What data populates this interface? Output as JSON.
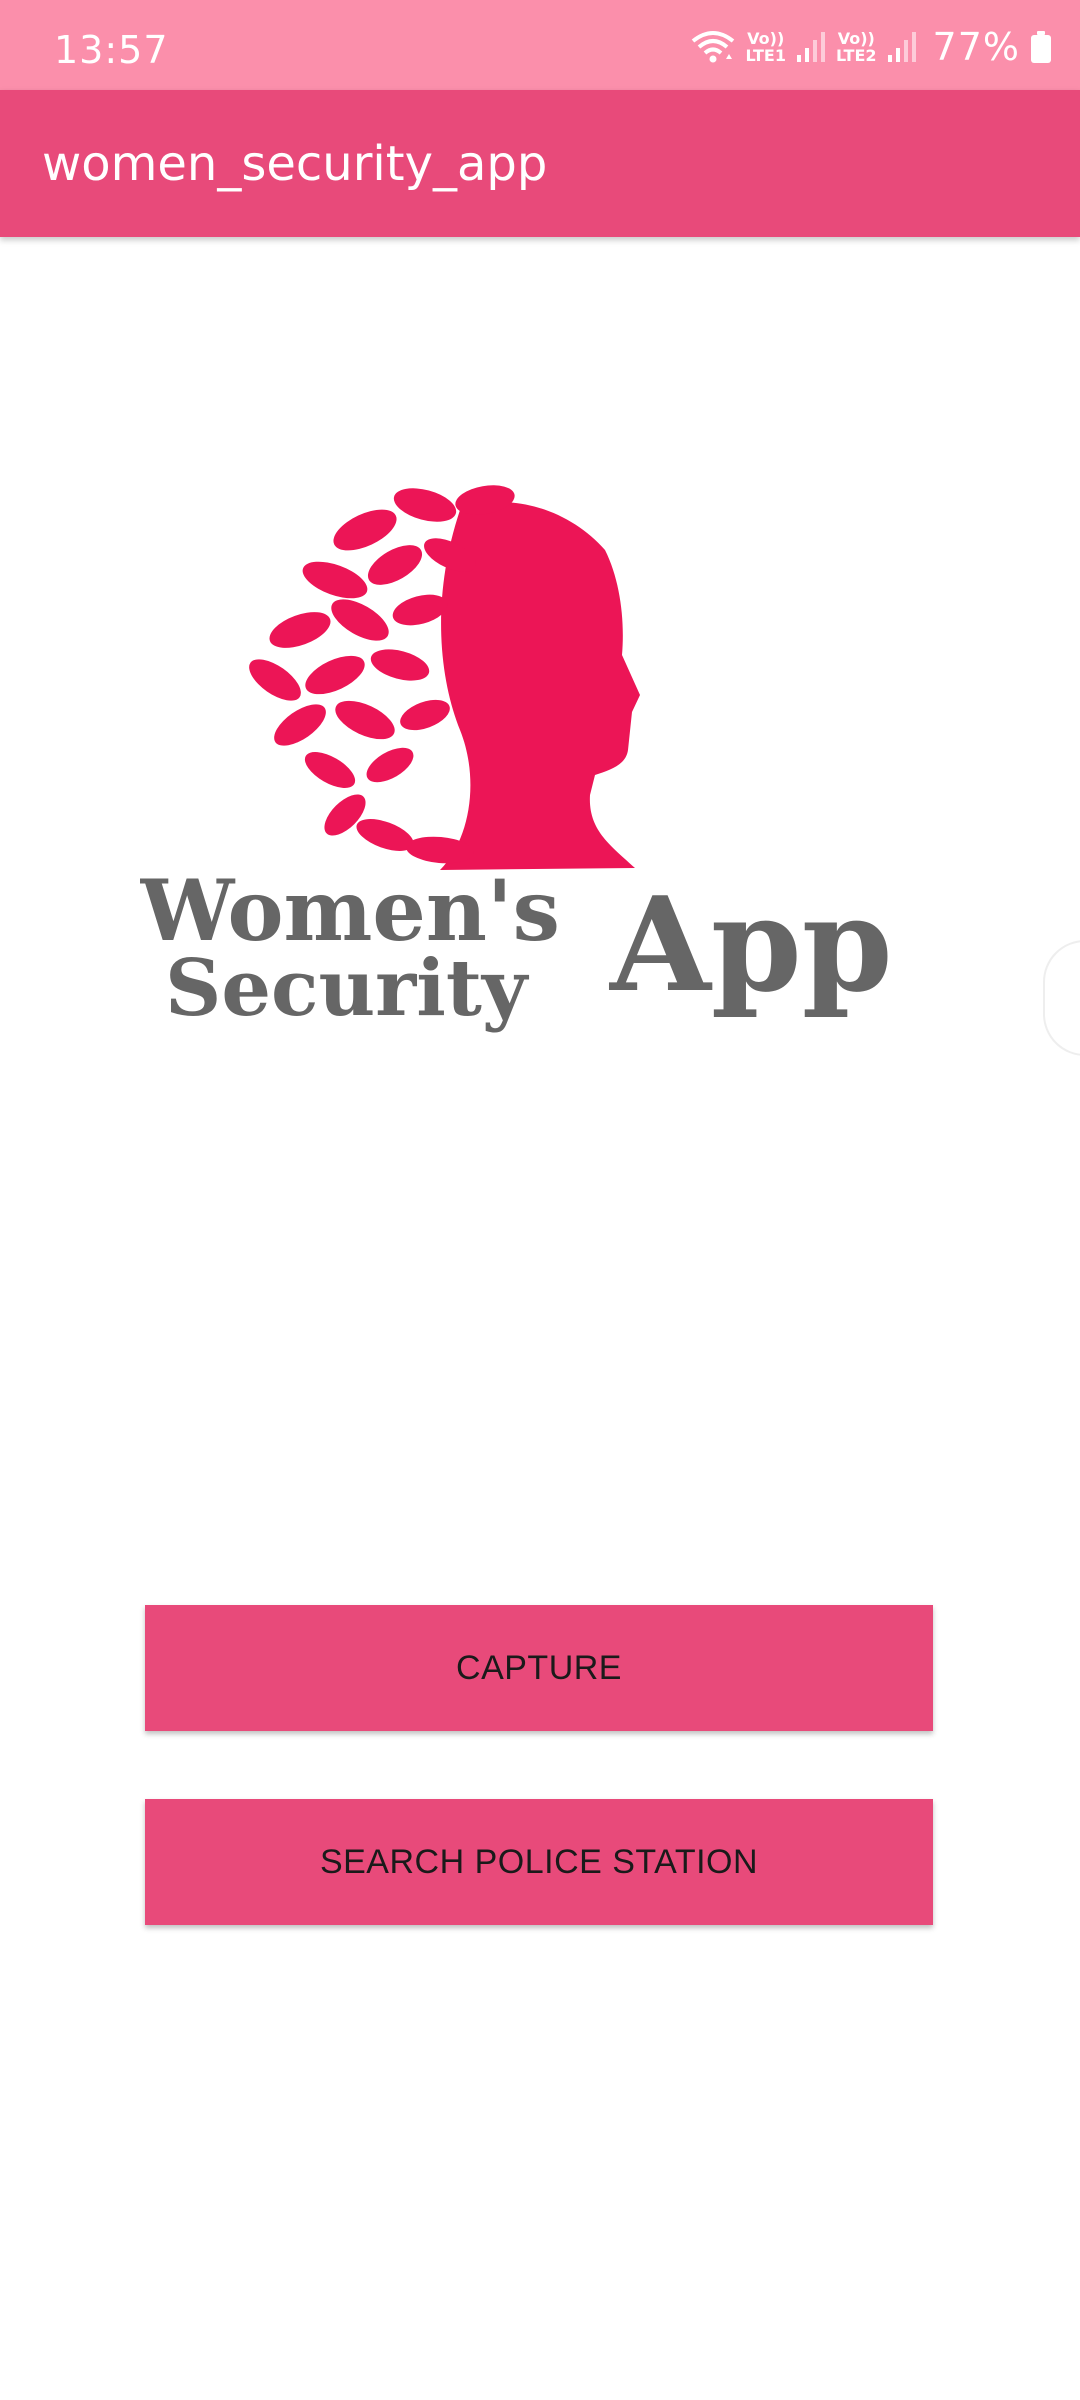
{
  "status_bar": {
    "time": "13:57",
    "sim1_top": "Vo))",
    "sim1_bottom": "LTE1",
    "sim2_top": "Vo))",
    "sim2_bottom": "LTE2",
    "battery": "77%",
    "icons": [
      "wifi-icon",
      "signal-icon",
      "signal-icon",
      "battery-icon"
    ]
  },
  "app_bar": {
    "title": "women_security_app"
  },
  "logo": {
    "line1": "Women's",
    "line2": "Security",
    "line3": "App",
    "colors": {
      "silhouette": "#ec1556",
      "text": "#666666"
    }
  },
  "buttons": {
    "capture": "CAPTURE",
    "search_police": "SEARCH POLICE STATION"
  },
  "colors": {
    "status_bar": "#fb8fab",
    "app_bar": "#e84a7a",
    "button": "#e84a7a"
  }
}
